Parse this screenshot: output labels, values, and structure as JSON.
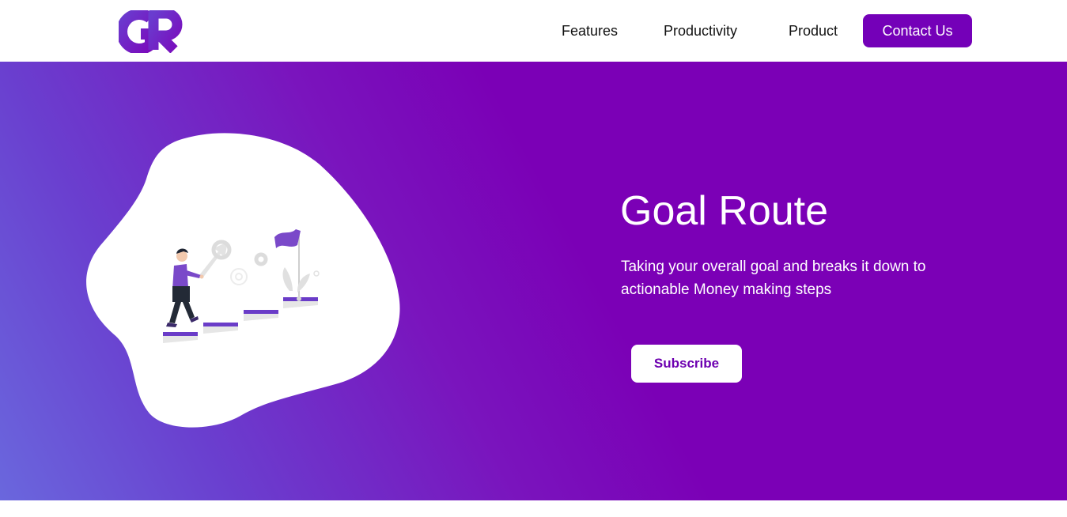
{
  "brand": {
    "logo_icon": "gr-logo-icon",
    "colors": {
      "primary": "#7400b8",
      "hero_start": "#6a67dd",
      "hero_end": "#7b00b6"
    }
  },
  "nav": {
    "links": [
      "Features",
      "Productivity",
      "Product"
    ],
    "cta": "Contact Us"
  },
  "hero": {
    "title": "Goal Route",
    "description": "Taking your overall goal and breaks it down to actionable Money making steps",
    "button": "Subscribe",
    "illustration": "man-climbing-stairs-to-flag-illustration"
  }
}
